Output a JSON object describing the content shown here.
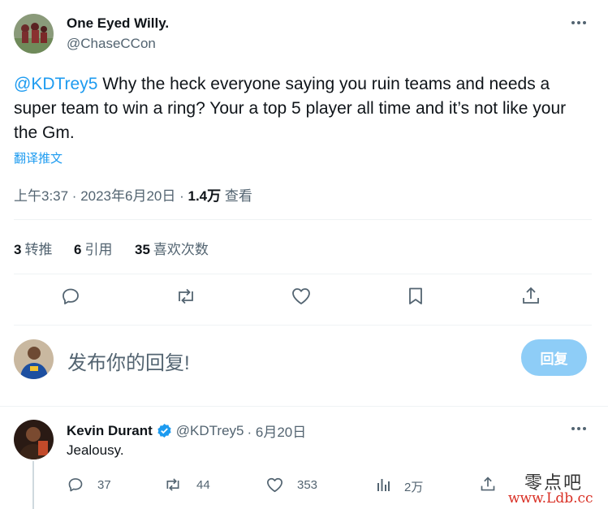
{
  "main_tweet": {
    "author_name": "One Eyed Willy.",
    "author_handle": "@ChaseCCon",
    "mention": "@KDTrey5",
    "text": " Why the heck everyone saying you ruin teams and needs a super team to win a ring? Your a top 5 player all time and it’s not like your the Gm.",
    "translate_label": "翻译推文",
    "time": "上午3:37 · 2023年6月20日 · ",
    "views_count": "1.4万",
    "views_label": " 查看"
  },
  "stats": {
    "retweets_count": "3",
    "retweets_label": "转推",
    "quotes_count": "6",
    "quotes_label": "引用",
    "likes_count": "35",
    "likes_label": "喜欢次数"
  },
  "compose": {
    "placeholder": "发布你的回复!",
    "reply_button": "回复"
  },
  "reply": {
    "author_name": "Kevin Durant",
    "author_handle": "@KDTrey5",
    "date": "· 6月20日",
    "text": "Jealousy.",
    "replies": "37",
    "retweets": "44",
    "likes": "353",
    "views": "2万"
  },
  "watermark": {
    "line1": "零点吧",
    "line2": "www.Ldb.cc"
  },
  "colors": {
    "accent": "#1d9bf0",
    "verified": "#1d9bf0",
    "reply_button_disabled": "#8ecdf7",
    "watermark_red": "#d93025"
  }
}
